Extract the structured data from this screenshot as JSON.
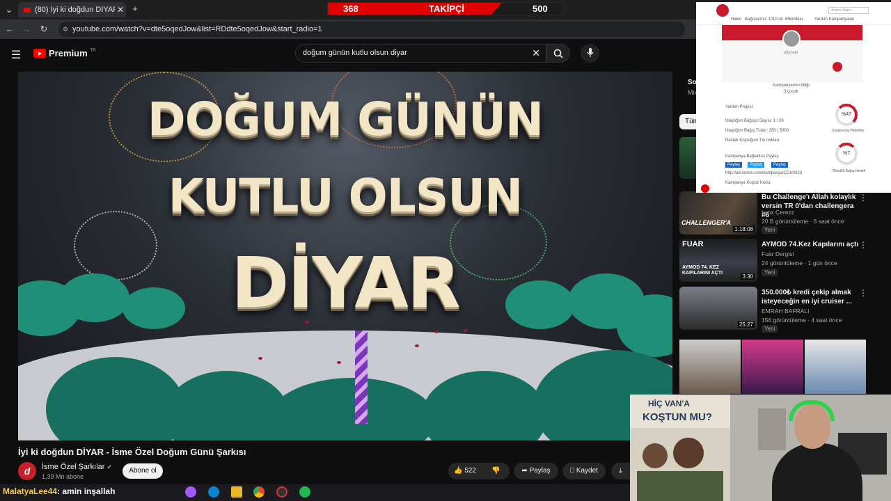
{
  "browser": {
    "tab_title": "(80) İyi ki doğdun DİYAR - İsme",
    "url": "youtube.com/watch?v=dte5oqedJow&list=RDdte5oqedJow&start_radio=1"
  },
  "stream_overlay": {
    "followers_current": "368",
    "followers_label": "TAKİPÇİ",
    "followers_goal": "500",
    "chat_user": "MalatyaLee44",
    "chat_message": ": amin inşallah"
  },
  "youtube": {
    "logo_text": "Premium",
    "region": "TR",
    "search_query": "doğum günün kutlu olsun diyar",
    "video": {
      "title": "İyi ki doğdun DİYAR - İsme Özel Doğum Günü Şarkısı",
      "overlay_line1": "DOĞUM GÜNÜN",
      "overlay_line2": "KUTLU OLSUN",
      "overlay_line3": "DİYAR"
    },
    "channel": {
      "avatar_letter": "d",
      "name": "İsme Özel Şarkılar",
      "subscribers": "1,39 Mn abone",
      "subscribe_label": "Abone ol"
    },
    "actions": {
      "likes": "522",
      "share": "Paylaş",
      "save": "Kaydet"
    },
    "partial_labels": {
      "sort": "Sor",
      "mix": "Mix",
      "all_filter": "Tüm"
    },
    "sidebar": [
      {
        "title": "Bu Challenge'ı Allah kolaylık versin TR 0'dan challengera #6",
        "channel": "Lynx Çerezz",
        "meta": "20 B görüntüleme · 6 saat önce",
        "badge": "Yeni",
        "duration": "1:18:08",
        "thumb_text": "CHALLENGER'A"
      },
      {
        "title": "AYMOD 74.Kez Kapılarını açtı",
        "channel": "Fuar Dergisi",
        "meta": "24 görüntüleme · 1 gün önce",
        "badge": "Yeni",
        "duration": "3:30",
        "thumb_text": "FUAR",
        "thumb_sub": "AYMOD 74. KEZ KAPILARINI AÇTI"
      },
      {
        "title": "350.000₺ kredi çekip almak isteyeceğin en iyi cruiser ...",
        "channel": "EMRAH BAFRALI",
        "meta": "156 görüntüleme · 4 saat önce",
        "badge": "Yeni",
        "duration": "25:27"
      }
    ]
  },
  "webpage_overlay": {
    "nav_search_placeholder": "Arama Yapın...",
    "nav_items": [
      "Hakkı",
      "Bağışlarınız 1010 lar",
      "Etkinlikler",
      "Yardım Kampanyaları"
    ],
    "username": "aliunver",
    "campaign_label": "Kampanyamın bitiği",
    "campaign_count": "3 çocuk",
    "rows": [
      "Yardım Projesi:",
      "Ulaştığım Bağışçı Sayısı: 1 / 20",
      "Ulaştığım Bağış Tutarı: 350 / 5000",
      "Destek Koştuğum Tık mıktarı:",
      "Kampanya Bağlantısı Paylaş"
    ],
    "social_btn": [
      "Paylaş",
      "Paylaş",
      "Paylaş"
    ],
    "link": "http://ad.motim.com/kampanya/CCH2023",
    "code_label": "Kampanya Kopsiz Kodu:",
    "percent1": "%47",
    "percent2": "%7",
    "percent1_label": "Kampanya Hedefine",
    "percent2_label": "Gönüllü Bağış Hedefi"
  },
  "ad_overlay": {
    "line1": "HİÇ VAN'A",
    "line2": "KOŞTUN MU?"
  },
  "colors": {
    "youtube_red": "#ff0000",
    "follower_red": "#e10000",
    "cake_green": "#1f8f78"
  }
}
